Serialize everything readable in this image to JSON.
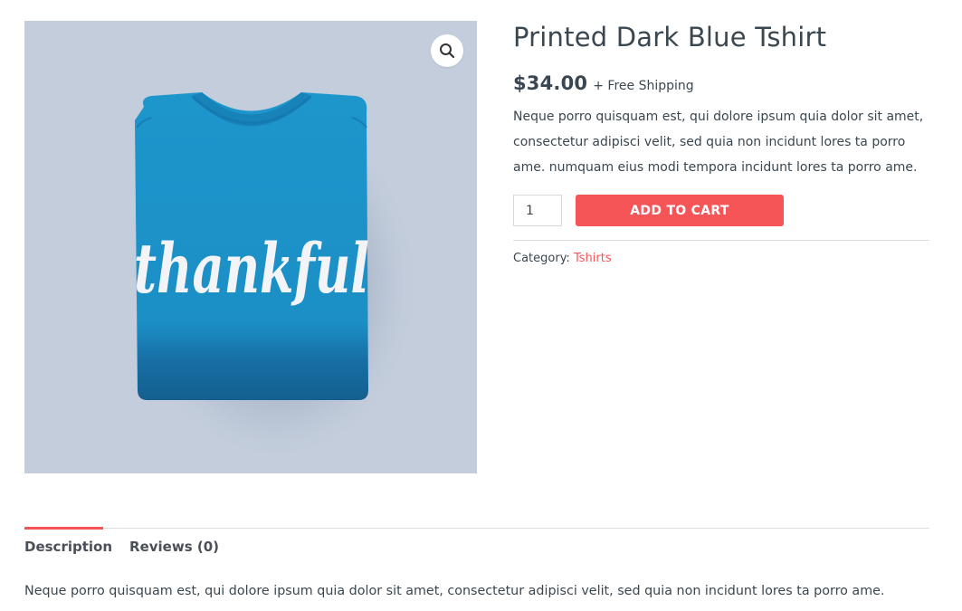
{
  "product": {
    "title": "Printed Dark Blue Tshirt",
    "price": "$34.00",
    "shipping": "+ Free Shipping",
    "short_description": "Neque porro quisquam est, qui dolore ipsum quia dolor sit amet, consectetur adipisci velit, sed quia non incidunt lores ta porro ame. numquam eius modi tempora incidunt lores ta porro ame.",
    "image_text": "thankful",
    "category_label": "Category:",
    "category_value": "Tshirts"
  },
  "cart": {
    "quantity": "1",
    "add_label": "ADD TO CART"
  },
  "gallery": {
    "zoom_icon": "search-icon"
  },
  "tabs": [
    {
      "label": "Description"
    },
    {
      "label": "Reviews (0)"
    }
  ],
  "tab_panel": {
    "text": "Neque porro quisquam est, qui dolore ipsum quia dolor sit amet, consectetur adipisci velit, sed quia non incidunt lores ta porro ame."
  },
  "colors": {
    "accent": "#f65558",
    "image_background": "#c3cddc",
    "shirt": "#1b90c6",
    "text": "#3a4750"
  }
}
